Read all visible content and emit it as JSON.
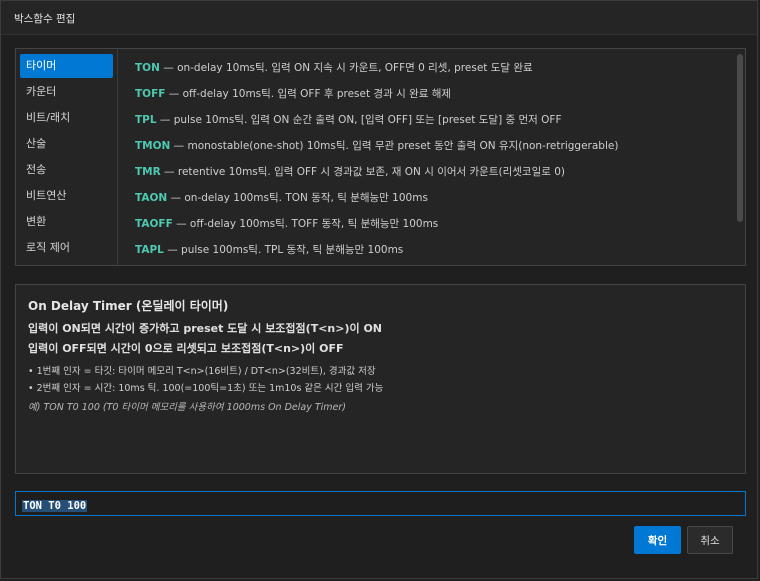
{
  "window": {
    "title": "박스함수 편집"
  },
  "categories": [
    {
      "label": "타이머",
      "selected": true
    },
    {
      "label": "카운터",
      "selected": false
    },
    {
      "label": "비트/래치",
      "selected": false
    },
    {
      "label": "산술",
      "selected": false
    },
    {
      "label": "전송",
      "selected": false
    },
    {
      "label": "비트연산",
      "selected": false
    },
    {
      "label": "변환",
      "selected": false
    },
    {
      "label": "로직 제어",
      "selected": false
    }
  ],
  "functions": [
    {
      "name": "TON",
      "desc": " — on-delay 10ms틱. 입력 ON 지속 시 카운트, OFF면 0 리셋, preset 도달 완료"
    },
    {
      "name": "TOFF",
      "desc": " — off-delay 10ms틱. 입력 OFF 후 preset 경과 시 완료 해제"
    },
    {
      "name": "TPL",
      "desc": " — pulse 10ms틱. 입력 ON 순간 출력 ON, [입력 OFF] 또는 [preset 도달] 중 먼저 OFF"
    },
    {
      "name": "TMON",
      "desc": " — monostable(one-shot) 10ms틱. 입력 무관 preset 동안 출력 ON 유지(non-retriggerable)"
    },
    {
      "name": "TMR",
      "desc": " — retentive 10ms틱. 입력 OFF 시 경과값 보존, 재 ON 시 이어서 카운트(리셋코일로 0)"
    },
    {
      "name": "TAON",
      "desc": " — on-delay 100ms틱. TON 동작, 틱 분해능만 100ms"
    },
    {
      "name": "TAOFF",
      "desc": " — off-delay 100ms틱. TOFF 동작, 틱 분해능만 100ms"
    },
    {
      "name": "TAPL",
      "desc": " — pulse 100ms틱. TPL 동작, 틱 분해능만 100ms"
    }
  ],
  "info": {
    "title": "On Delay Timer (온딜레이 타이머)",
    "line1": "입력이 ON되면 시간이 증가하고 preset 도달 시 보조접점(T<n>)이 ON",
    "line2": "입력이 OFF되면 시간이 0으로 리셋되고 보조접점(T<n>)이 OFF",
    "bullet1": "• 1번째 인자 = 타깃: 타이머 메모리 T<n>(16비트) / DT<n>(32비트), 경과값 저장",
    "bullet2": "• 2번째 인자 = 시간: 10ms 틱. 100(=100틱=1초) 또는 1m10s 같은 시간 입력 가능",
    "example": "예) TON T0 100 (T0 타이머 메모리를 사용하여 1000ms On Delay Timer)"
  },
  "input": {
    "value": "TON T0 100"
  },
  "buttons": {
    "ok": "확인",
    "cancel": "취소"
  },
  "colors": {
    "accent": "#0078d4",
    "keyword": "#4ec9b0",
    "background": "#1f1f1f"
  }
}
